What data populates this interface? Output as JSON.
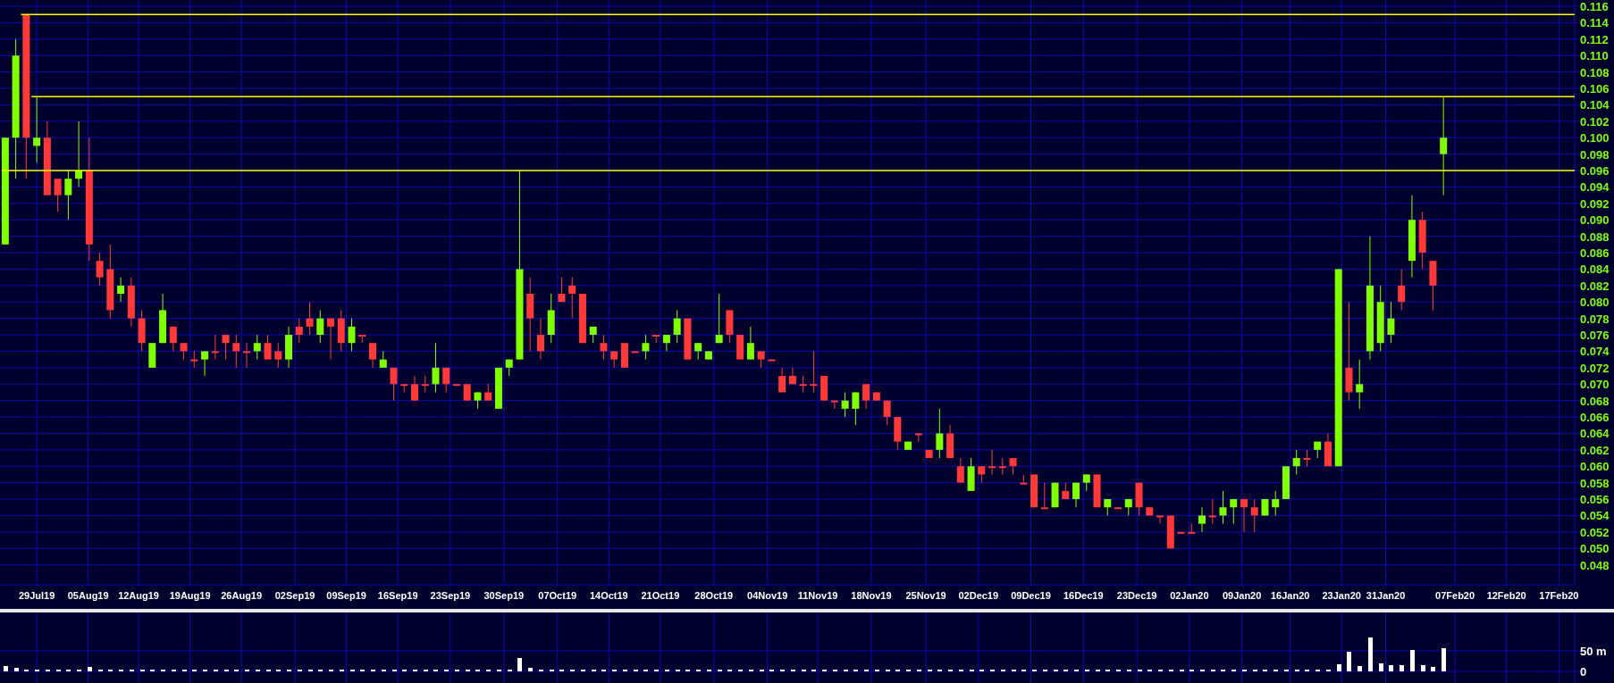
{
  "price_chart": {
    "price_labels": [
      "0.116",
      "0.114",
      "0.112",
      "0.110",
      "0.108",
      "0.106",
      "0.104",
      "0.102",
      "0.100",
      "0.098",
      "0.096",
      "0.094",
      "0.092",
      "0.090",
      "0.088",
      "0.086",
      "0.084",
      "0.082",
      "0.080",
      "0.078",
      "0.076",
      "0.074",
      "0.072",
      "0.070",
      "0.068",
      "0.066",
      "0.064",
      "0.062",
      "0.060",
      "0.058",
      "0.056",
      "0.054",
      "0.052",
      "0.050",
      "0.048"
    ],
    "date_labels": [
      "29Jul19",
      "05Aug19",
      "12Aug19",
      "19Aug19",
      "26Aug19",
      "02Sep19",
      "09Sep19",
      "16Sep19",
      "23Sep19",
      "30Sep19",
      "07Oct19",
      "14Oct19",
      "21Oct19",
      "28Oct19",
      "04Nov19",
      "11Nov19",
      "18Nov19",
      "25Nov19",
      "02Dec19",
      "09Dec19",
      "16Dec19",
      "23Dec19",
      "02Jan20",
      "09Jan20",
      "16Jan20",
      "23Jan20",
      "31Jan20",
      "07Feb20",
      "12Feb20",
      "17Feb20"
    ]
  },
  "volume_chart": {
    "chart_data": {
      "type": "bar",
      "ylim": [
        -28,
        143
      ],
      "grid": true,
      "yticks": [
        {
          "value": 0,
          "label": "0"
        },
        {
          "value": 50,
          "label": "50 m"
        }
      ],
      "values": [
        13,
        9,
        4,
        4,
        4,
        4,
        4,
        4,
        11,
        4,
        4,
        4,
        4,
        4,
        4,
        4,
        4,
        4,
        4,
        4,
        4,
        4,
        4,
        4,
        4,
        4,
        4,
        4,
        4,
        4,
        4,
        4,
        4,
        4,
        4,
        4,
        4,
        4,
        4,
        4,
        4,
        4,
        4,
        4,
        4,
        4,
        4,
        4,
        4,
        33,
        9,
        4,
        4,
        4,
        4,
        4,
        4,
        4,
        4,
        4,
        4,
        4,
        4,
        4,
        4,
        4,
        4,
        4,
        4,
        4,
        4,
        4,
        4,
        4,
        4,
        4,
        4,
        4,
        4,
        4,
        4,
        4,
        4,
        4,
        4,
        4,
        4,
        4,
        4,
        4,
        4,
        4,
        4,
        4,
        4,
        4,
        4,
        4,
        4,
        4,
        4,
        4,
        4,
        4,
        4,
        4,
        4,
        4,
        4,
        4,
        4,
        4,
        4,
        4,
        4,
        4,
        4,
        4,
        4,
        4,
        4,
        4,
        4,
        4,
        4,
        4,
        4,
        17,
        48,
        13,
        82,
        20,
        15,
        15,
        52,
        15,
        11,
        57,
        null,
        null,
        null,
        null,
        null,
        null,
        null,
        null,
        null,
        null,
        null,
        null
      ]
    }
  }
}
